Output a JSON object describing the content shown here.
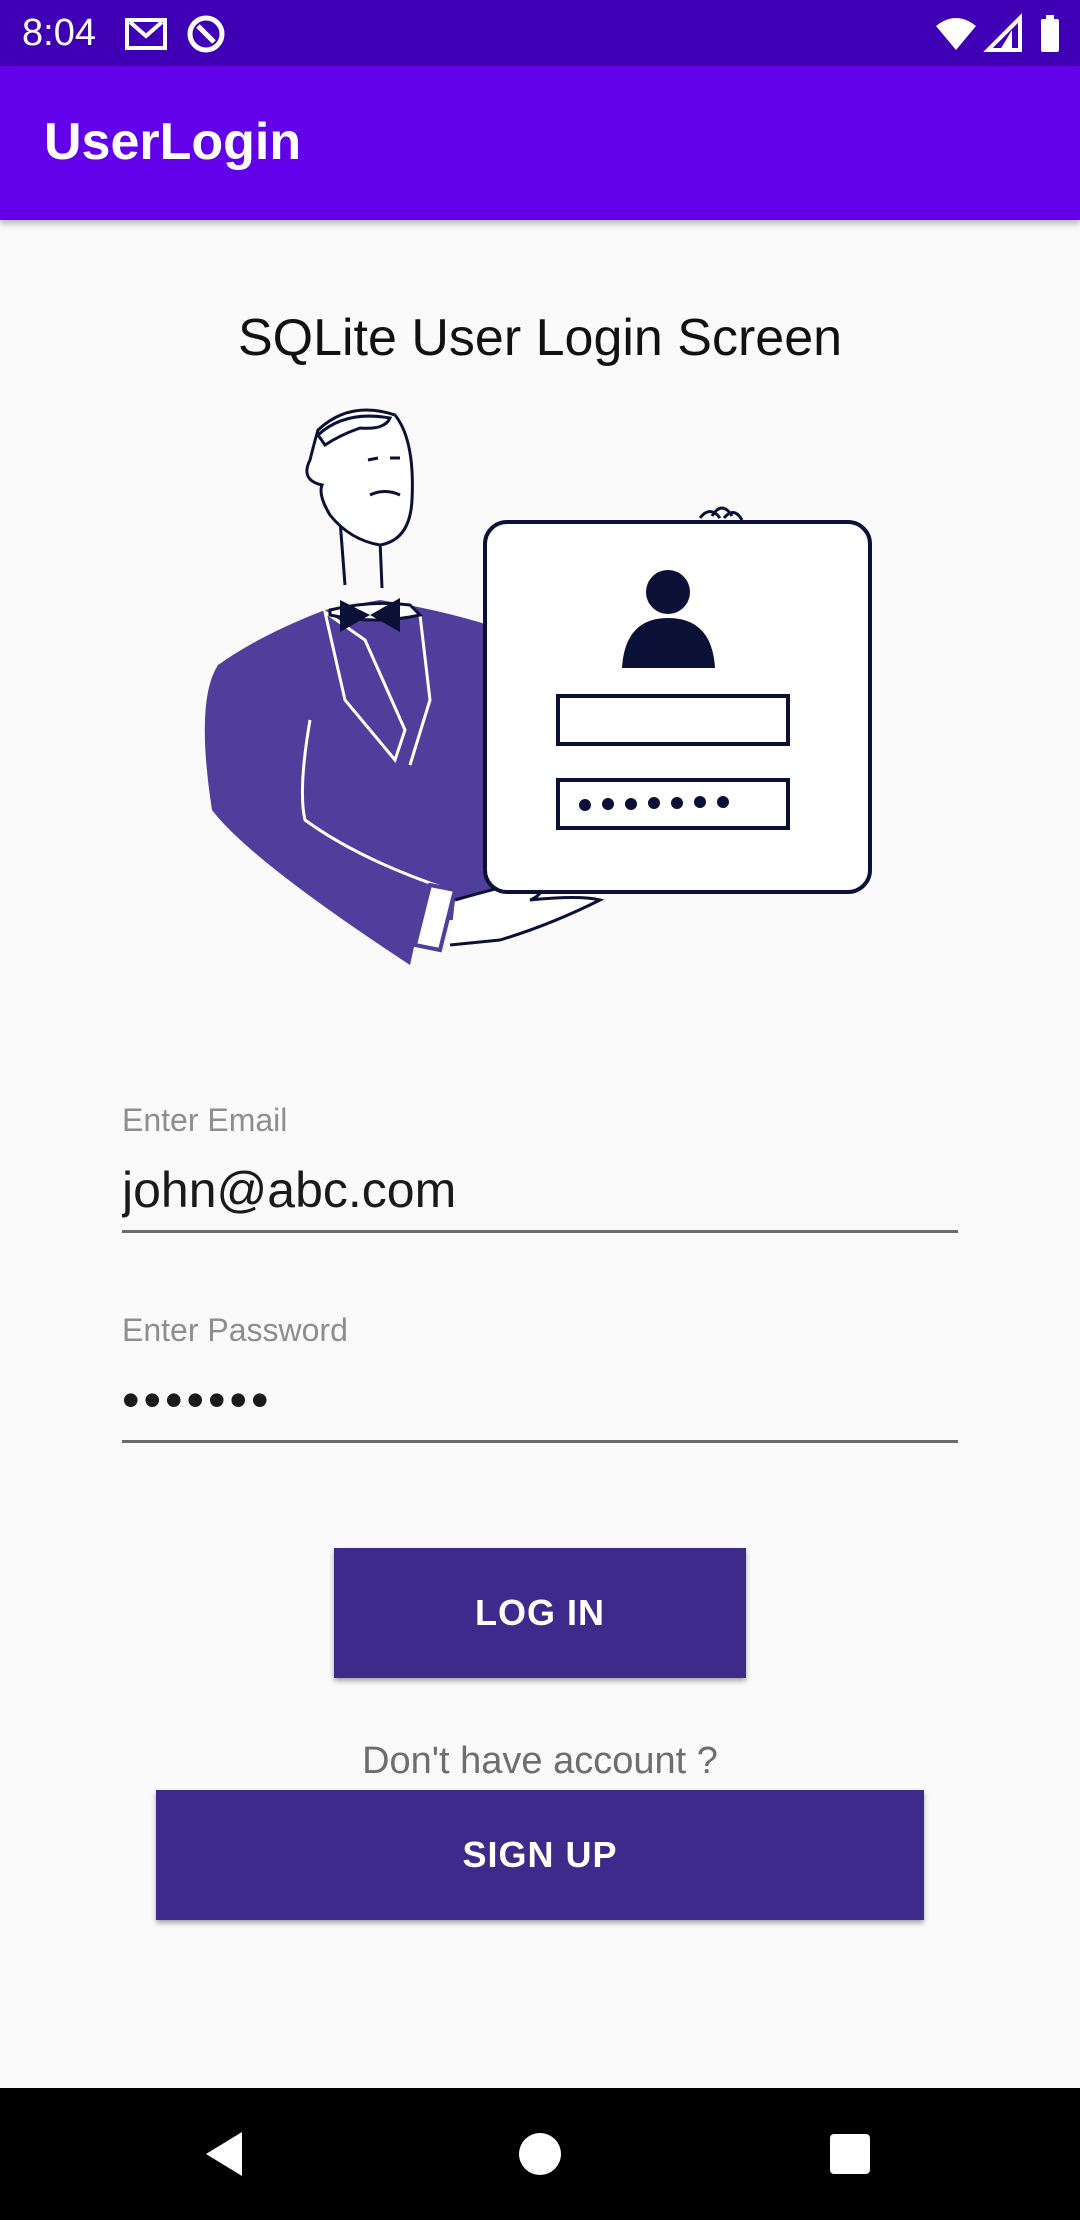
{
  "status_bar": {
    "time": "8:04",
    "icons": [
      "gmail-icon",
      "sync-icon",
      "wifi-icon",
      "signal-icon",
      "battery-icon"
    ]
  },
  "app_bar": {
    "title": "UserLogin"
  },
  "main": {
    "heading": "SQLite User Login Screen",
    "illustration": "man-presenting-login-form-illustration",
    "email": {
      "label": "Enter Email",
      "value": "john@abc.com"
    },
    "password": {
      "label": "Enter Password",
      "value": "•••••••"
    },
    "login_button": "LOG IN",
    "signup_prompt": "Don't have account ?",
    "signup_button": "SIGN UP"
  },
  "nav_bar": {
    "icons": [
      "back-icon",
      "home-icon",
      "recents-icon"
    ]
  },
  "colors": {
    "status_bar": "#3f00b5",
    "app_bar": "#6200ea",
    "button": "#3d2a8a",
    "illustration_accent": "#503e9d",
    "illustration_ink": "#0b1136"
  }
}
